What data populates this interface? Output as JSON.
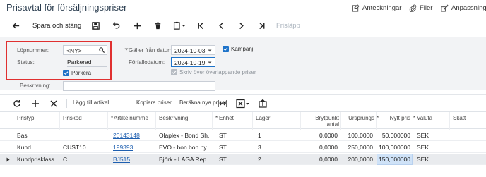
{
  "title": "Prisavtal för försäljningspriser",
  "top_links": {
    "notes": "Anteckningar",
    "files": "Filer",
    "customize": "Anpassning"
  },
  "toolbar": {
    "save_close": "Spara och stäng",
    "release": "Frisläpp"
  },
  "form": {
    "lopnummer_label": "Löpnummer:",
    "lopnummer_value": "<NY>",
    "status_label": "Status:",
    "status_value": "Parkerad",
    "parkera_label": "Parkera",
    "galler_label": "Gäller från datum:",
    "galler_value": "2024-10-03",
    "forfallo_label": "Förfallodatum:",
    "forfallo_value": "2024-10-19",
    "kampanj_label": "Kampanj",
    "skriv_over_label": "Skriv över överlappande priser",
    "beskrivning_label": "Beskrivning:",
    "beskrivning_value": ""
  },
  "grid_toolbar": {
    "add_article": "Lägg till artikel",
    "copy_prices": "Kopiera priser",
    "calc_prices": "Beräkna nya priser"
  },
  "grid": {
    "headers": {
      "pristyp": "Pristyp",
      "priskod": "Priskod",
      "artikelnummer": "Artikelnumme",
      "beskrivning": "Beskrivning",
      "enhet": "Enhet",
      "lager": "Lager",
      "brytpunkt_1": "Brytpunkt",
      "brytpunkt_2": "antal",
      "ursprung": "Ursprungs",
      "nytt_pris": "Nytt pris",
      "valuta": "Valuta",
      "skatt": "Skatt"
    },
    "rows": [
      {
        "pristyp": "Bas",
        "priskod": "",
        "artikel": "20143148",
        "beskrivning": "Olaplex - Bond Sh...",
        "enhet": "ST",
        "lager": "1",
        "brytpunkt": "0,0000",
        "ursprung": "100,0000",
        "nytt_pris": "50,000000",
        "valuta": "SEK"
      },
      {
        "pristyp": "Kund",
        "priskod": "CUST10",
        "artikel": "199393",
        "beskrivning": "EVO - bon bon hy...",
        "enhet": "ST",
        "lager": "3",
        "brytpunkt": "0,0000",
        "ursprung": "250,0000",
        "nytt_pris": "100,000000",
        "valuta": "SEK"
      },
      {
        "pristyp": "Kundprisklass",
        "priskod": "C",
        "artikel": "BJ515",
        "beskrivning": "Björk - LAGA Rep...",
        "enhet": "ST",
        "lager": "2",
        "brytpunkt": "0,0000",
        "ursprung": "200,0000",
        "nytt_pris": "150,000000",
        "valuta": "SEK"
      }
    ]
  }
}
